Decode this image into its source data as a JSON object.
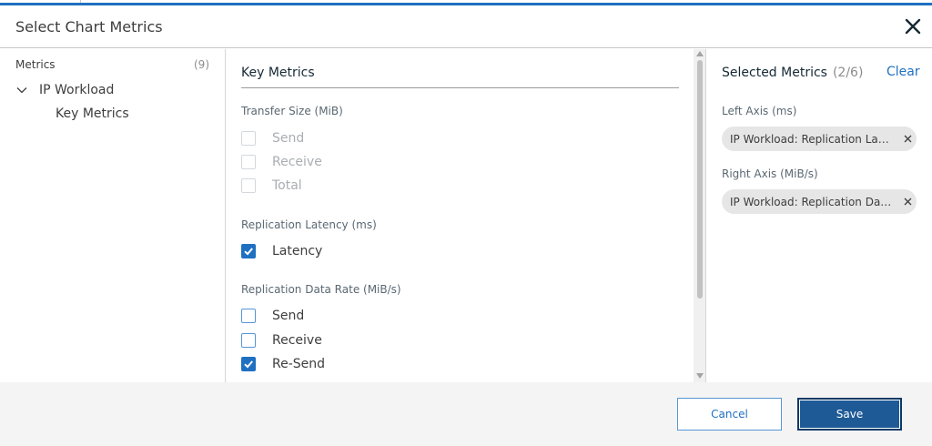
{
  "dialog": {
    "title": "Select Chart Metrics",
    "close_icon": "close-icon"
  },
  "left_panel": {
    "metrics_label": "Metrics",
    "metrics_count": "(9)",
    "tree": {
      "parent_label": "IP Workload",
      "parent_expanded": true,
      "child_label": "Key Metrics"
    }
  },
  "middle_panel": {
    "title": "Key Metrics",
    "groups": [
      {
        "label": "Transfer Size (MiB)",
        "options": [
          {
            "label": "Send",
            "checked": false,
            "disabled": true
          },
          {
            "label": "Receive",
            "checked": false,
            "disabled": true
          },
          {
            "label": "Total",
            "checked": false,
            "disabled": true
          }
        ]
      },
      {
        "label": "Replication Latency (ms)",
        "options": [
          {
            "label": "Latency",
            "checked": true,
            "disabled": false
          }
        ]
      },
      {
        "label": "Replication Data Rate (MiB/s)",
        "options": [
          {
            "label": "Send",
            "checked": false,
            "disabled": false
          },
          {
            "label": "Receive",
            "checked": false,
            "disabled": false
          },
          {
            "label": "Re-Send",
            "checked": true,
            "disabled": false
          }
        ]
      }
    ]
  },
  "right_panel": {
    "title": "Selected Metrics",
    "count": "(2/6)",
    "clear_label": "Clear",
    "left_axis_label": "Left Axis (ms)",
    "left_axis_chip": "IP Workload: Replication Latency",
    "right_axis_label": "Right Axis (MiB/s)",
    "right_axis_chip": "IP Workload: Replication Data Rate"
  },
  "footer": {
    "cancel_label": "Cancel",
    "save_label": "Save"
  },
  "colors": {
    "accent": "#1f70c1",
    "save_button": "#1e5a96",
    "footer_bg": "#f4f4f4",
    "chip_bg": "#e6e6e6"
  }
}
